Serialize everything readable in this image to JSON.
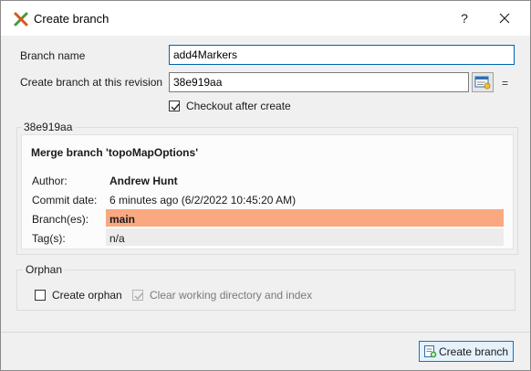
{
  "window": {
    "title": "Create branch",
    "help_label": "?",
    "close_label": "✕"
  },
  "form": {
    "branch_name_label": "Branch name",
    "branch_name_value": "add4Markers",
    "revision_label": "Create branch at this revision",
    "revision_value": "38e919aa",
    "equals_label": "=",
    "checkout_label": "Checkout after create",
    "checkout_checked": true
  },
  "commit_info": {
    "group_label": "38e919aa",
    "message": "Merge branch 'topoMapOptions'",
    "author_label": "Author:",
    "author_value": "Andrew Hunt",
    "date_label": "Commit date:",
    "date_value": "6 minutes ago (6/2/2022 10:45:20 AM)",
    "branches_label": "Branch(es):",
    "branches_value": "main",
    "tags_label": "Tag(s):",
    "tags_value": "n/a",
    "branch_highlight_color": "#f9a882",
    "tags_highlight_color": "#ececec"
  },
  "orphan": {
    "group_label": "Orphan",
    "create_orphan_label": "Create orphan",
    "create_orphan_checked": false,
    "clear_label": "Clear working directory and index",
    "clear_checked": true,
    "clear_disabled": true
  },
  "footer": {
    "create_button_label": "Create branch"
  },
  "background": {
    "partial_glyph": "6"
  }
}
